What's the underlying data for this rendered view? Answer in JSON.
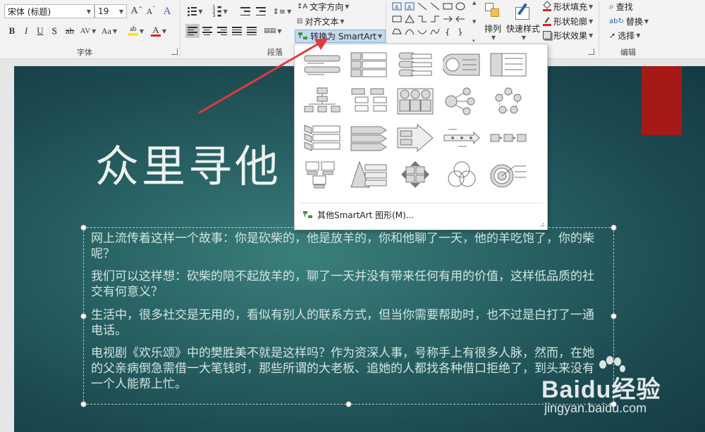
{
  "font_group": {
    "font_name": "宋体 (标题)",
    "font_size": "19",
    "grow_icon": "A",
    "shrink_icon": "A",
    "clear_icon": "A",
    "bold": "B",
    "italic": "I",
    "underline": "U",
    "shadow": "S",
    "strike": "ab",
    "spacing": "AV",
    "case": "Aa",
    "highlight_glyph": "ab",
    "font_color_glyph": "A",
    "label": "字体"
  },
  "paragraph_group": {
    "text_direction": "文字方向",
    "align_text": "对齐文本",
    "convert_smartart": "转换为 SmartArt",
    "label": "段落"
  },
  "drawing_group": {
    "arrange": "排列",
    "quick_styles": "快速样式",
    "shape_fill": "形状填充",
    "shape_outline": "形状轮廓",
    "shape_effects": "形状效果"
  },
  "editing_group": {
    "find": "查找",
    "replace": "替换",
    "select": "选择",
    "label": "编辑"
  },
  "smartart_menu": {
    "more": "其他SmartArt 图形(M)..."
  },
  "slide": {
    "title": "众里寻他",
    "paragraphs": [
      "网上流传着这样一个故事：你是砍柴的，他是放羊的，你和他聊了一天，他的羊吃饱了，你的柴呢？",
      "我们可以这样想：砍柴的陪不起放羊的，聊了一天并没有带来任何有用的价值，这样低品质的社交有何意义？",
      "生活中，很多社交是无用的，看似有别人的联系方式，但当你需要帮助时，也不过是白打了一通电话。",
      "电视剧《欢乐颂》中的樊胜美不就是这样吗？作为资深人事，号称手上有很多人脉，然而，在她的父亲病倒急需借一大笔钱时，那些所谓的大老板、追她的人都找各种借口拒绝了，到头来没有一个人能帮上忙。"
    ]
  },
  "watermark": {
    "brand": "Baidu经验",
    "url": "jingyan.baidu.com"
  },
  "colors": {
    "accent_red": "#a51a17",
    "arrow": "#e0393e",
    "slide_bg": "#2a6466"
  }
}
